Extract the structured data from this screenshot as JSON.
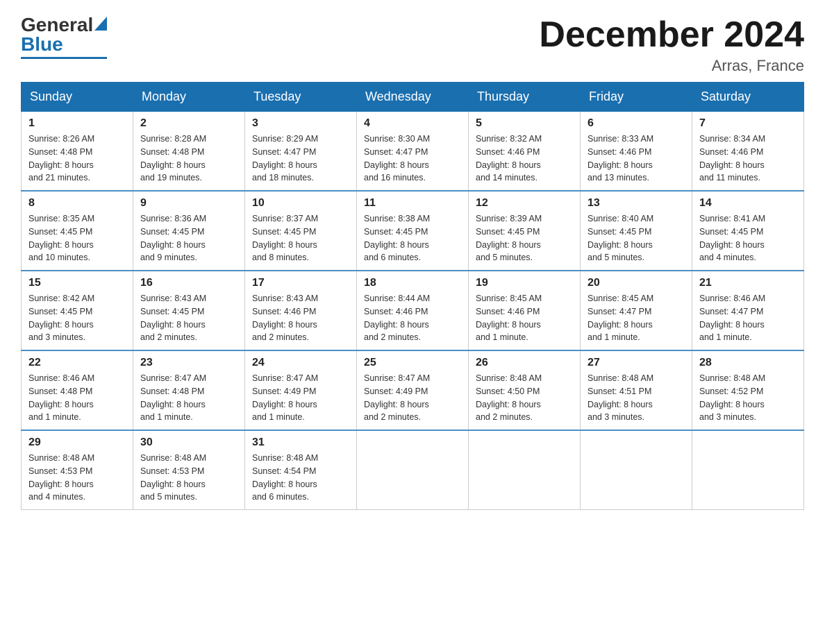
{
  "logo": {
    "text_general": "General",
    "text_blue": "Blue"
  },
  "header": {
    "title": "December 2024",
    "location": "Arras, France"
  },
  "weekdays": [
    "Sunday",
    "Monday",
    "Tuesday",
    "Wednesday",
    "Thursday",
    "Friday",
    "Saturday"
  ],
  "weeks": [
    [
      {
        "day": "1",
        "sunrise": "8:26 AM",
        "sunset": "4:48 PM",
        "daylight": "8 hours and 21 minutes."
      },
      {
        "day": "2",
        "sunrise": "8:28 AM",
        "sunset": "4:48 PM",
        "daylight": "8 hours and 19 minutes."
      },
      {
        "day": "3",
        "sunrise": "8:29 AM",
        "sunset": "4:47 PM",
        "daylight": "8 hours and 18 minutes."
      },
      {
        "day": "4",
        "sunrise": "8:30 AM",
        "sunset": "4:47 PM",
        "daylight": "8 hours and 16 minutes."
      },
      {
        "day": "5",
        "sunrise": "8:32 AM",
        "sunset": "4:46 PM",
        "daylight": "8 hours and 14 minutes."
      },
      {
        "day": "6",
        "sunrise": "8:33 AM",
        "sunset": "4:46 PM",
        "daylight": "8 hours and 13 minutes."
      },
      {
        "day": "7",
        "sunrise": "8:34 AM",
        "sunset": "4:46 PM",
        "daylight": "8 hours and 11 minutes."
      }
    ],
    [
      {
        "day": "8",
        "sunrise": "8:35 AM",
        "sunset": "4:45 PM",
        "daylight": "8 hours and 10 minutes."
      },
      {
        "day": "9",
        "sunrise": "8:36 AM",
        "sunset": "4:45 PM",
        "daylight": "8 hours and 9 minutes."
      },
      {
        "day": "10",
        "sunrise": "8:37 AM",
        "sunset": "4:45 PM",
        "daylight": "8 hours and 8 minutes."
      },
      {
        "day": "11",
        "sunrise": "8:38 AM",
        "sunset": "4:45 PM",
        "daylight": "8 hours and 6 minutes."
      },
      {
        "day": "12",
        "sunrise": "8:39 AM",
        "sunset": "4:45 PM",
        "daylight": "8 hours and 5 minutes."
      },
      {
        "day": "13",
        "sunrise": "8:40 AM",
        "sunset": "4:45 PM",
        "daylight": "8 hours and 5 minutes."
      },
      {
        "day": "14",
        "sunrise": "8:41 AM",
        "sunset": "4:45 PM",
        "daylight": "8 hours and 4 minutes."
      }
    ],
    [
      {
        "day": "15",
        "sunrise": "8:42 AM",
        "sunset": "4:45 PM",
        "daylight": "8 hours and 3 minutes."
      },
      {
        "day": "16",
        "sunrise": "8:43 AM",
        "sunset": "4:45 PM",
        "daylight": "8 hours and 2 minutes."
      },
      {
        "day": "17",
        "sunrise": "8:43 AM",
        "sunset": "4:46 PM",
        "daylight": "8 hours and 2 minutes."
      },
      {
        "day": "18",
        "sunrise": "8:44 AM",
        "sunset": "4:46 PM",
        "daylight": "8 hours and 2 minutes."
      },
      {
        "day": "19",
        "sunrise": "8:45 AM",
        "sunset": "4:46 PM",
        "daylight": "8 hours and 1 minute."
      },
      {
        "day": "20",
        "sunrise": "8:45 AM",
        "sunset": "4:47 PM",
        "daylight": "8 hours and 1 minute."
      },
      {
        "day": "21",
        "sunrise": "8:46 AM",
        "sunset": "4:47 PM",
        "daylight": "8 hours and 1 minute."
      }
    ],
    [
      {
        "day": "22",
        "sunrise": "8:46 AM",
        "sunset": "4:48 PM",
        "daylight": "8 hours and 1 minute."
      },
      {
        "day": "23",
        "sunrise": "8:47 AM",
        "sunset": "4:48 PM",
        "daylight": "8 hours and 1 minute."
      },
      {
        "day": "24",
        "sunrise": "8:47 AM",
        "sunset": "4:49 PM",
        "daylight": "8 hours and 1 minute."
      },
      {
        "day": "25",
        "sunrise": "8:47 AM",
        "sunset": "4:49 PM",
        "daylight": "8 hours and 2 minutes."
      },
      {
        "day": "26",
        "sunrise": "8:48 AM",
        "sunset": "4:50 PM",
        "daylight": "8 hours and 2 minutes."
      },
      {
        "day": "27",
        "sunrise": "8:48 AM",
        "sunset": "4:51 PM",
        "daylight": "8 hours and 3 minutes."
      },
      {
        "day": "28",
        "sunrise": "8:48 AM",
        "sunset": "4:52 PM",
        "daylight": "8 hours and 3 minutes."
      }
    ],
    [
      {
        "day": "29",
        "sunrise": "8:48 AM",
        "sunset": "4:53 PM",
        "daylight": "8 hours and 4 minutes."
      },
      {
        "day": "30",
        "sunrise": "8:48 AM",
        "sunset": "4:53 PM",
        "daylight": "8 hours and 5 minutes."
      },
      {
        "day": "31",
        "sunrise": "8:48 AM",
        "sunset": "4:54 PM",
        "daylight": "8 hours and 6 minutes."
      },
      null,
      null,
      null,
      null
    ]
  ],
  "labels": {
    "sunrise_prefix": "Sunrise: ",
    "sunset_prefix": "Sunset: ",
    "daylight_prefix": "Daylight: "
  }
}
